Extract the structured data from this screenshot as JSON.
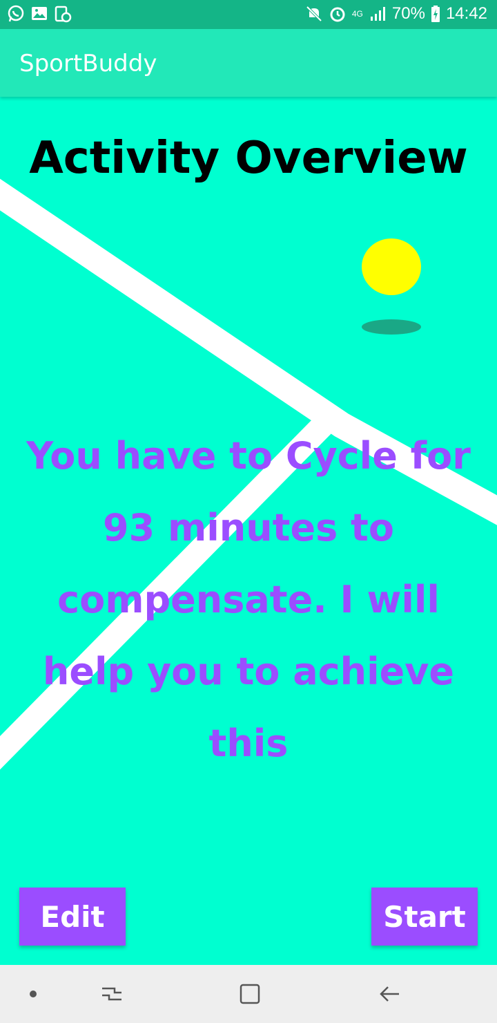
{
  "status_bar": {
    "left_icons": [
      "whatsapp-icon",
      "gallery-icon",
      "screenshot-icon"
    ],
    "right_icons": [
      "mute-icon",
      "alarm-icon",
      "4g-icon",
      "signal-icon",
      "battery-charging-icon"
    ],
    "network": "4G",
    "battery": "70%",
    "time": "14:42"
  },
  "app_bar": {
    "title": "SportBuddy"
  },
  "main": {
    "heading": "Activity Overview",
    "message": "You have to Cycle for 93 minutes to compensate. I will help you to achieve this",
    "edit_label": "Edit",
    "start_label": "Start"
  },
  "nav_bar": {
    "icons": [
      "dot-icon",
      "recent-apps-icon",
      "home-icon",
      "back-icon"
    ]
  },
  "colors": {
    "background": "#00ffd0",
    "app_bar": "#22e8b8",
    "status_bar": "#14b587",
    "accent": "#9b4dff",
    "ball": "#ffff00"
  }
}
